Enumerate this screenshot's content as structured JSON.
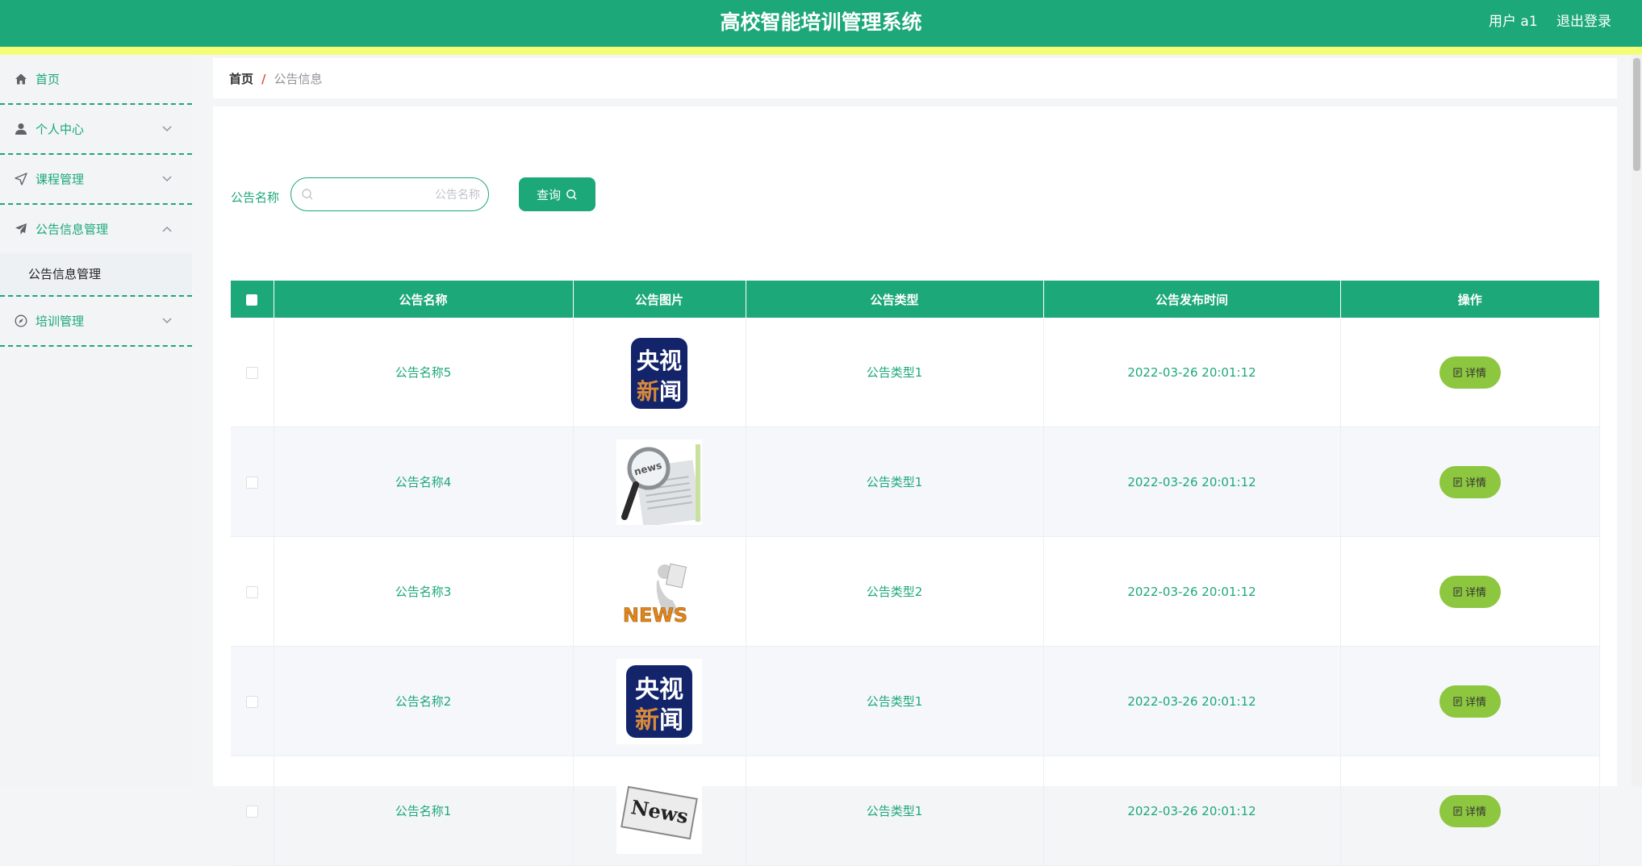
{
  "header": {
    "title": "高校智能培训管理系统",
    "user_label": "用户 a1",
    "logout_label": "退出登录"
  },
  "sidebar": {
    "items": [
      {
        "label": "首页",
        "icon": "home-icon"
      },
      {
        "label": "个人中心",
        "icon": "user-icon"
      },
      {
        "label": "课程管理",
        "icon": "navigation-icon"
      },
      {
        "label": "公告信息管理",
        "icon": "send-icon",
        "expanded": true
      },
      {
        "label": "培训管理",
        "icon": "compass-icon"
      }
    ],
    "submenu_label": "公告信息管理"
  },
  "breadcrumb": {
    "home": "首页",
    "separator": "/",
    "current": "公告信息"
  },
  "search": {
    "label": "公告名称",
    "placeholder": "公告名称",
    "value": "",
    "button_label": "查询"
  },
  "table": {
    "columns": [
      "公告名称",
      "公告图片",
      "公告类型",
      "公告发布时间",
      "操作"
    ],
    "rows": [
      {
        "name": "公告名称5",
        "image": "cctv-news-logo",
        "type": "公告类型1",
        "time": "2022-03-26 20:01:12",
        "action": "详情"
      },
      {
        "name": "公告名称4",
        "image": "magnifier-newspaper",
        "type": "公告类型1",
        "time": "2022-03-26 20:01:12",
        "action": "详情"
      },
      {
        "name": "公告名称3",
        "image": "news-figure",
        "type": "公告类型2",
        "time": "2022-03-26 20:01:12",
        "action": "详情"
      },
      {
        "name": "公告名称2",
        "image": "cctv-news-logo",
        "type": "公告类型1",
        "time": "2022-03-26 20:01:12",
        "action": "详情"
      },
      {
        "name": "公告名称1",
        "image": "news-paper",
        "type": "公告类型1",
        "time": "2022-03-26 20:01:12",
        "action": "详情"
      }
    ]
  },
  "images": {
    "cctv_logo": {
      "line1": "央视",
      "line2_a": "新",
      "line2_b": "闻"
    },
    "magnifier": {
      "text": "news"
    },
    "figure": {
      "text": "NEWS"
    },
    "paper": {
      "text": "News"
    }
  },
  "colors": {
    "primary": "#1ca878",
    "accent_strip": "#f5fd77",
    "detail_button": "#8dc63f",
    "breadcrumb_separator": "#e05a3a"
  }
}
